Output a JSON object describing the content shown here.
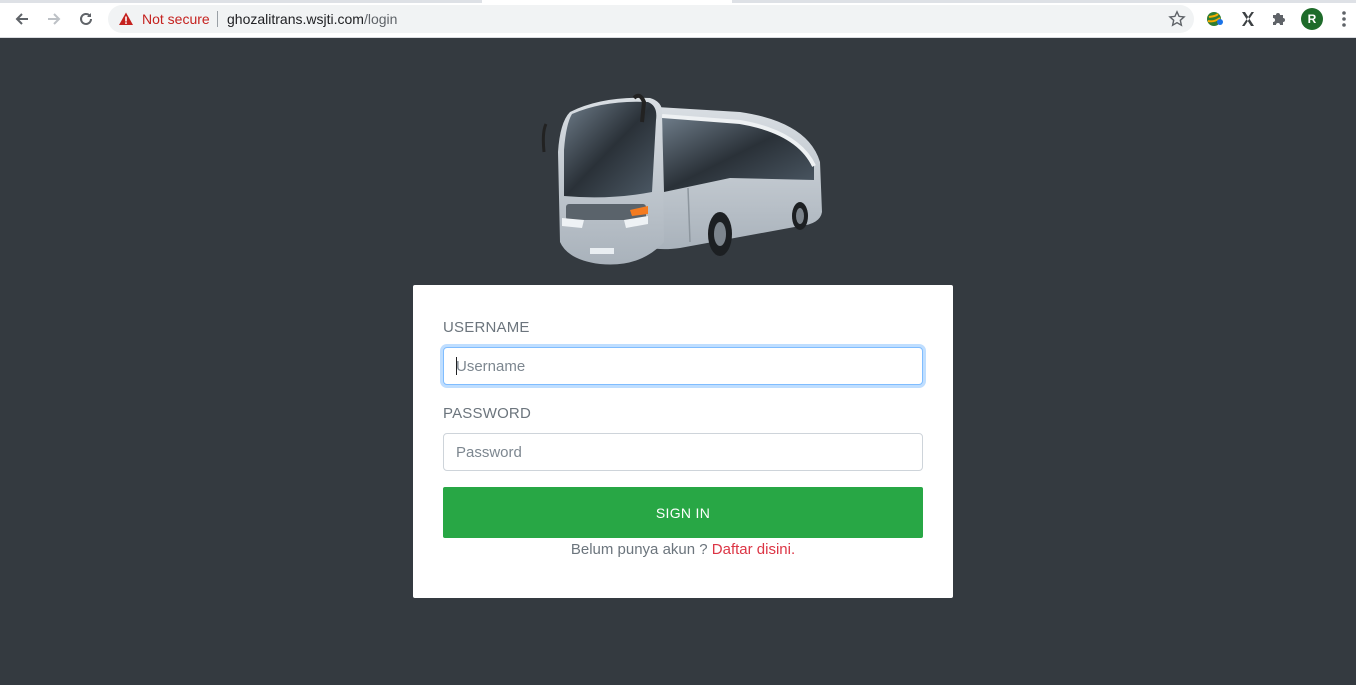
{
  "browser": {
    "security_label": "Not secure",
    "url_host": "ghozalitrans.wsjti.com",
    "url_path": "/login",
    "profile_initial": "R",
    "icons": {
      "back": "back-arrow-icon",
      "forward": "forward-arrow-icon",
      "reload": "reload-icon",
      "warning": "warning-icon",
      "bookmark": "star-icon",
      "extension1": "globe-extension-icon",
      "extension2": "x-extension-icon",
      "extensions": "puzzle-icon",
      "menu": "kebab-menu-icon"
    }
  },
  "page": {
    "hero_image": "bus-image",
    "background_color": "#343a40"
  },
  "login": {
    "username_label": "USERNAME",
    "username_placeholder": "Username",
    "password_label": "PASSWORD",
    "password_placeholder": "Password",
    "submit_label": "SIGN IN",
    "signup_prompt": "Belum punya akun ?",
    "signup_link": "Daftar disini.",
    "submit_color": "#28a745",
    "link_color": "#dc3545"
  }
}
